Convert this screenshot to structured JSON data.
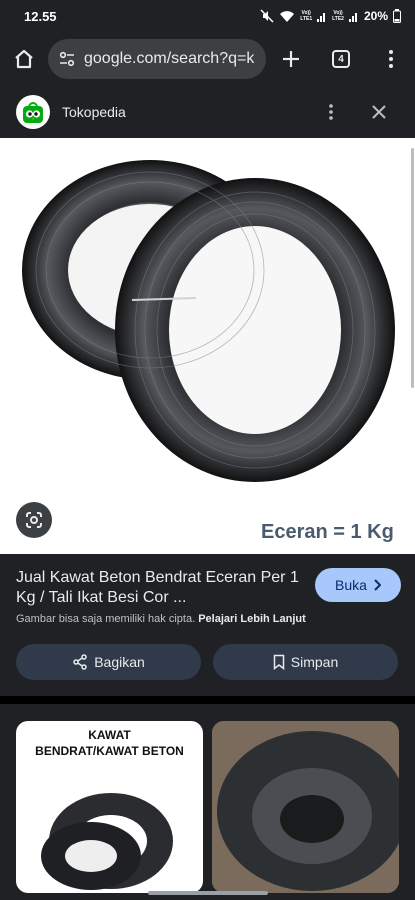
{
  "status_bar": {
    "time": "12.55",
    "net1": "Vo))\nLTE1",
    "net2": "Vo))\nLTE2",
    "battery": "20%"
  },
  "browser": {
    "url": "google.com/search?q=k",
    "tab_count": "4"
  },
  "source": {
    "name": "Tokopedia"
  },
  "image": {
    "caption": "Eceran = 1 Kg"
  },
  "detail": {
    "title": "Jual Kawat Beton Bendrat Eceran Per 1 Kg / Tali Ikat Besi Cor ...",
    "visit_label": "Buka",
    "copyright_text": "Gambar bisa saja memiliki hak cipta.",
    "learn_more": "Pelajari Lebih Lanjut",
    "share_label": "Bagikan",
    "save_label": "Simpan"
  },
  "related": {
    "thumb1_title": "KAWAT\nBENDRAT/KAWAT BETON"
  },
  "colors": {
    "surface": "#202124",
    "accent": "#a8c7fa",
    "button_bg": "#303a4a"
  }
}
